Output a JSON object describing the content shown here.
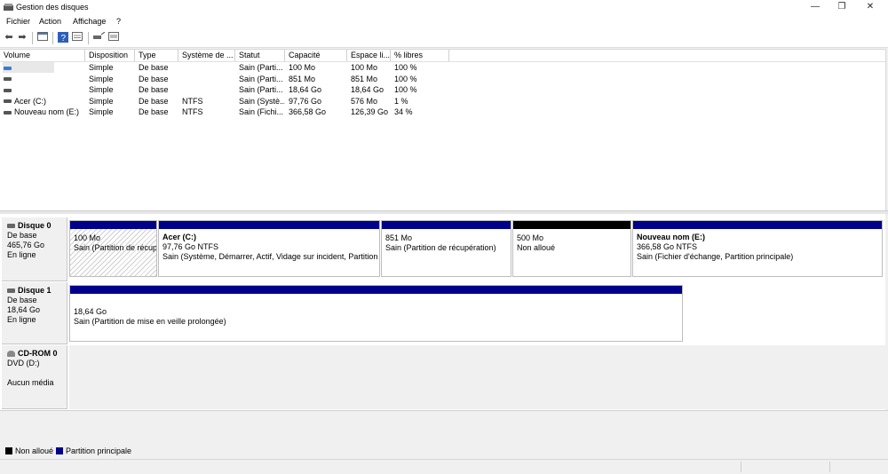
{
  "window": {
    "title": "Gestion des disques"
  },
  "menu": [
    "Fichier",
    "Action",
    "Affichage",
    "?"
  ],
  "toolbar": {
    "icons": [
      "back-icon",
      "forward-icon",
      "console-tree-icon",
      "help-icon",
      "properties-icon",
      "rescan-icon",
      "settings-icon"
    ]
  },
  "volume_list": {
    "columns": [
      "Volume",
      "Disposition",
      "Type",
      "Système de ...",
      "Statut",
      "Capacité",
      "Espace li...",
      "% libres"
    ],
    "rows": [
      {
        "volume": "",
        "disposition": "Simple",
        "type": "De base",
        "fs": "",
        "status": "Sain (Parti...",
        "capacity": "100 Mo",
        "free": "100 Mo",
        "pct": "100 %"
      },
      {
        "volume": "",
        "disposition": "Simple",
        "type": "De base",
        "fs": "",
        "status": "Sain (Parti...",
        "capacity": "851 Mo",
        "free": "851 Mo",
        "pct": "100 %"
      },
      {
        "volume": "",
        "disposition": "Simple",
        "type": "De base",
        "fs": "",
        "status": "Sain (Parti...",
        "capacity": "18,64 Go",
        "free": "18,64 Go",
        "pct": "100 %"
      },
      {
        "volume": "Acer (C:)",
        "disposition": "Simple",
        "type": "De base",
        "fs": "NTFS",
        "status": "Sain (Systè...",
        "capacity": "97,76 Go",
        "free": "576 Mo",
        "pct": "1 %"
      },
      {
        "volume": "Nouveau nom (E:)",
        "disposition": "Simple",
        "type": "De base",
        "fs": "NTFS",
        "status": "Sain (Fichi...",
        "capacity": "366,58 Go",
        "free": "126,39 Go",
        "pct": "34 %"
      }
    ]
  },
  "disks": [
    {
      "name": "Disque 0",
      "type": "De base",
      "size": "465,76 Go",
      "state": "En ligne",
      "partitions": [
        {
          "name": "",
          "size": "100 Mo",
          "status": "Sain (Partition de récup"
        },
        {
          "name": "Acer  (C:)",
          "size": "97,76 Go NTFS",
          "status": "Sain (Système, Démarrer, Actif, Vidage sur incident, Partition p"
        },
        {
          "name": "",
          "size": "851 Mo",
          "status": "Sain (Partition de récupération)"
        },
        {
          "name": "",
          "size": "500 Mo",
          "status": "Non alloué"
        },
        {
          "name": "Nouveau nom  (E:)",
          "size": "366,58 Go NTFS",
          "status": "Sain (Fichier d'échange, Partition principale)"
        }
      ]
    },
    {
      "name": "Disque 1",
      "type": "De base",
      "size": "18,64 Go",
      "state": "En ligne",
      "partitions": [
        {
          "name": "",
          "size": "18,64 Go",
          "status": "Sain (Partition de mise en veille prolongée)"
        }
      ]
    },
    {
      "name": "CD-ROM 0",
      "type": "DVD (D:)",
      "size": "",
      "state": "Aucun média",
      "partitions": []
    }
  ],
  "legend": [
    {
      "label": "Non alloué",
      "color": "#000000"
    },
    {
      "label": "Partition principale",
      "color": "#00008b"
    }
  ],
  "colors": {
    "primary_partition": "#00008b",
    "unallocated": "#000000"
  }
}
